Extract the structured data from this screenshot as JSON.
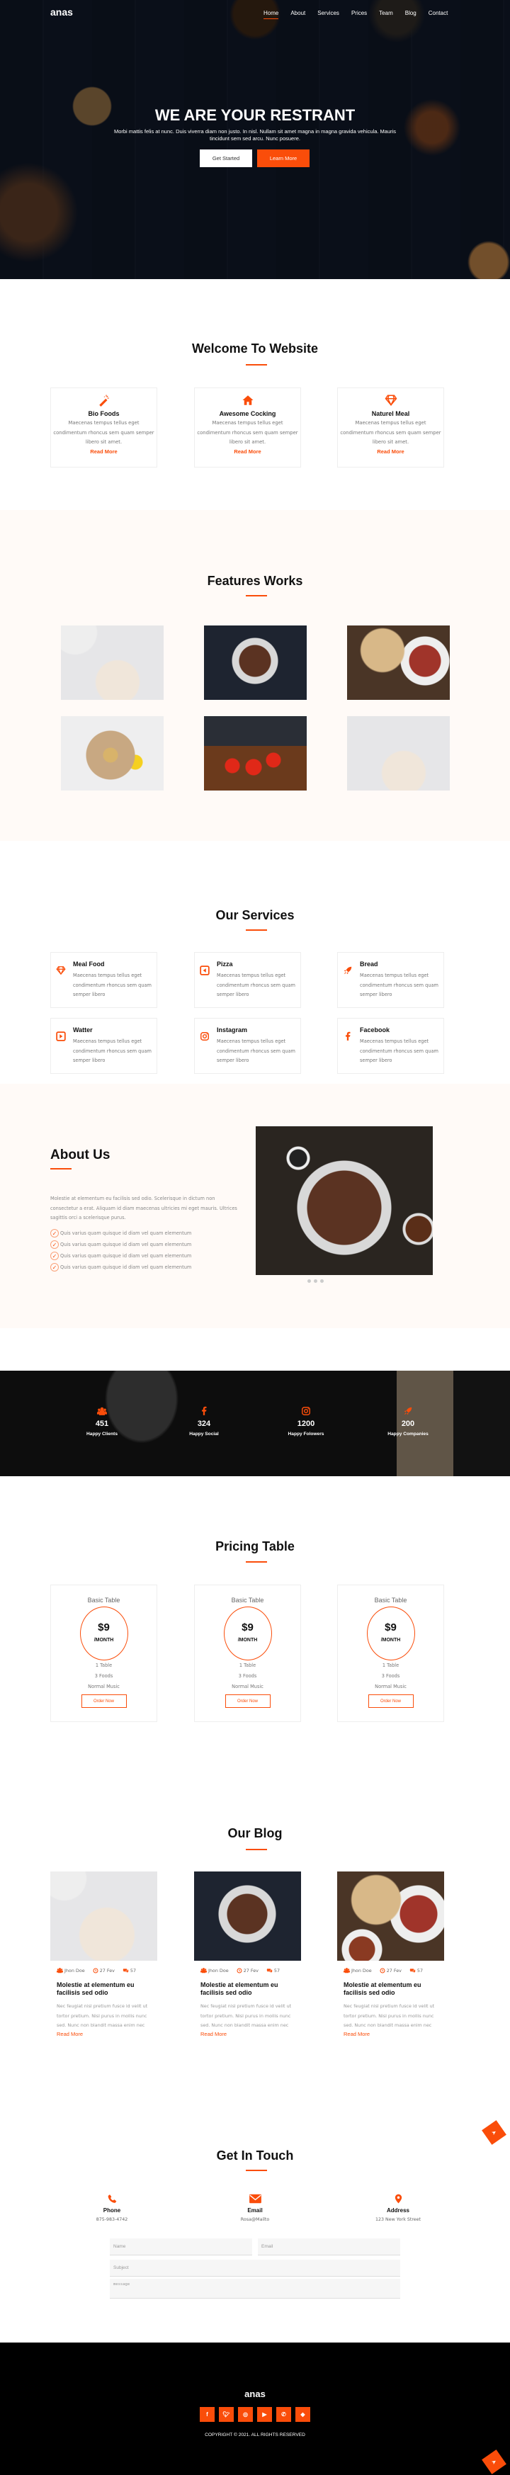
{
  "header": {
    "logo": "anas",
    "nav": [
      {
        "label": "Home",
        "active": true
      },
      {
        "label": "About",
        "active": false
      },
      {
        "label": "Services",
        "active": false
      },
      {
        "label": "Prices",
        "active": false
      },
      {
        "label": "Team",
        "active": false
      },
      {
        "label": "Blog",
        "active": false
      },
      {
        "label": "Contact",
        "active": false
      }
    ]
  },
  "hero": {
    "title": "WE ARE YOUR RESTRANT",
    "subtitle": "Morbi mattis felis at nunc. Duis viverra diam non justo. In nisl. Nullam sit amet magna in magna gravida vehicula. Mauris tincidunt sem sed arcu. Nunc posuere.",
    "primary_button": "Get Started",
    "secondary_button": "Learn More"
  },
  "welcome": {
    "title": "Welcome To Website",
    "cards": [
      {
        "icon": "magic-wand-icon",
        "title": "Bio Foods",
        "text": "Maecenas tempus tellus eget condimentum rhoncus sem quam semper libero sit amet.",
        "link": "Read More"
      },
      {
        "icon": "home-icon",
        "title": "Awesome Cocking",
        "text": "Maecenas tempus tellus eget condimentum rhoncus sem quam semper libero sit amet.",
        "link": "Read More"
      },
      {
        "icon": "diamond-icon",
        "title": "Naturel Meal",
        "text": "Maecenas tempus tellus eget condimentum rhoncus sem quam semper libero sit amet.",
        "link": "Read More"
      }
    ]
  },
  "features": {
    "title": "Features Works",
    "images": [
      "noodle-salad-plates",
      "steak-salad-bowl",
      "stew-and-pie",
      "lemon-dish",
      "tomato-appetizers",
      "noodle-salad-plates"
    ]
  },
  "services": {
    "title": "Our Services",
    "items": [
      {
        "icon": "diamond-icon",
        "title": "Meal Food",
        "text": "Maecenas tempus tellus eget condimentum rhoncus sem quam semper libero"
      },
      {
        "icon": "play-left-icon",
        "title": "Pizza",
        "text": "Maecenas tempus tellus eget condimentum rhoncus sem quam semper libero"
      },
      {
        "icon": "rocket-icon",
        "title": "Bread",
        "text": "Maecenas tempus tellus eget condimentum rhoncus sem quam semper libero"
      },
      {
        "icon": "play-icon",
        "title": "Watter",
        "text": "Maecenas tempus tellus eget condimentum rhoncus sem quam semper libero"
      },
      {
        "icon": "instagram-icon",
        "title": "Instagram",
        "text": "Maecenas tempus tellus eget condimentum rhoncus sem quam semper libero"
      },
      {
        "icon": "facebook-icon",
        "title": "Facebook",
        "text": "Maecenas tempus tellus eget condimentum rhoncus sem quam semper libero"
      }
    ]
  },
  "about": {
    "title": "About Us",
    "text": "Molestie at elementum eu facilisis sed odio. Scelerisque in dictum non consectetur a erat. Aliquam id diam maecenas ultricies mi eget mauris. Ultrices sagittis orci a scelerisque purus.",
    "list": [
      "Quis varius quam quisque id diam vel quam elementum",
      "Quis varius quam quisque id diam vel quam elementum",
      "Quis varius quam quisque id diam vel quam elementum",
      "Quis varius quam quisque id diam vel quam elementum"
    ],
    "carousel_slides": 3
  },
  "stats": [
    {
      "icon": "users-icon",
      "value": "451",
      "label": "Happy Clients"
    },
    {
      "icon": "facebook-icon",
      "value": "324",
      "label": "Happy Social"
    },
    {
      "icon": "instagram-icon",
      "value": "1200",
      "label": "Happy Folowers"
    },
    {
      "icon": "rocket-icon",
      "value": "200",
      "label": "Happy Companies"
    }
  ],
  "pricing": {
    "title": "Pricing Table",
    "plans": [
      {
        "name": "Basic Table",
        "price": "$9",
        "period": "/MONTH",
        "features": [
          "1 Table",
          "3 Foods",
          "Normal Music"
        ],
        "button": "Order Now"
      },
      {
        "name": "Basic Table",
        "price": "$9",
        "period": "/MONTH",
        "features": [
          "1 Table",
          "3 Foods",
          "Normal Music"
        ],
        "button": "Order Now"
      },
      {
        "name": "Basic Table",
        "price": "$9",
        "period": "/MONTH",
        "features": [
          "1 Table",
          "3 Foods",
          "Normal Music"
        ],
        "button": "Order Now"
      }
    ]
  },
  "blog": {
    "title": "Our Blog",
    "posts": [
      {
        "author": "Jhon Doe",
        "date": "27 Fev",
        "comments": "57",
        "title": "Molestie at elementum eu facilisis sed odio",
        "text": "Nec feugiat nisl pretium fusce id velit ut tortor pretium. Nisl purus in mollis nunc sed. Nunc non blandit massa enim nec",
        "link": "Read More"
      },
      {
        "author": "Jhon Doe",
        "date": "27 Fev",
        "comments": "57",
        "title": "Molestie at elementum eu facilisis sed odio",
        "text": "Nec feugiat nisl pretium fusce id velit ut tortor pretium. Nisl purus in mollis nunc sed. Nunc non blandit massa enim nec",
        "link": "Read More"
      },
      {
        "author": "Jhon Doe",
        "date": "27 Fev",
        "comments": "57",
        "title": "Molestie at elementum eu facilisis sed odio",
        "text": "Nec feugiat nisl pretium fusce id velit ut tortor pretium. Nisl purus in mollis nunc sed. Nunc non blandit massa enim nec",
        "link": "Read More"
      }
    ]
  },
  "contact": {
    "title": "Get In Touch",
    "info": [
      {
        "icon": "phone-icon",
        "label": "Phone",
        "value": "875-983-4742"
      },
      {
        "icon": "mail-icon",
        "label": "Email",
        "value": "Rosa@Mailto"
      },
      {
        "icon": "map-pin-icon",
        "label": "Address",
        "value": "123 New York Street"
      }
    ],
    "form": {
      "name_placeholder": "Name",
      "email_placeholder": "Email",
      "subject_placeholder": "Subject",
      "message_placeholder": "message"
    }
  },
  "footer": {
    "logo": "anas",
    "socials": [
      "facebook-icon",
      "twitter-icon",
      "instagram-icon",
      "youtube-icon",
      "whatsapp-icon",
      "diamond-icon"
    ],
    "copyright": "COPYRIGHT © 2021. ALL RIGHTS RESERVED"
  },
  "colors": {
    "accent": "#fa4d0a",
    "band": "#fffaf7",
    "footer": "#000000"
  }
}
